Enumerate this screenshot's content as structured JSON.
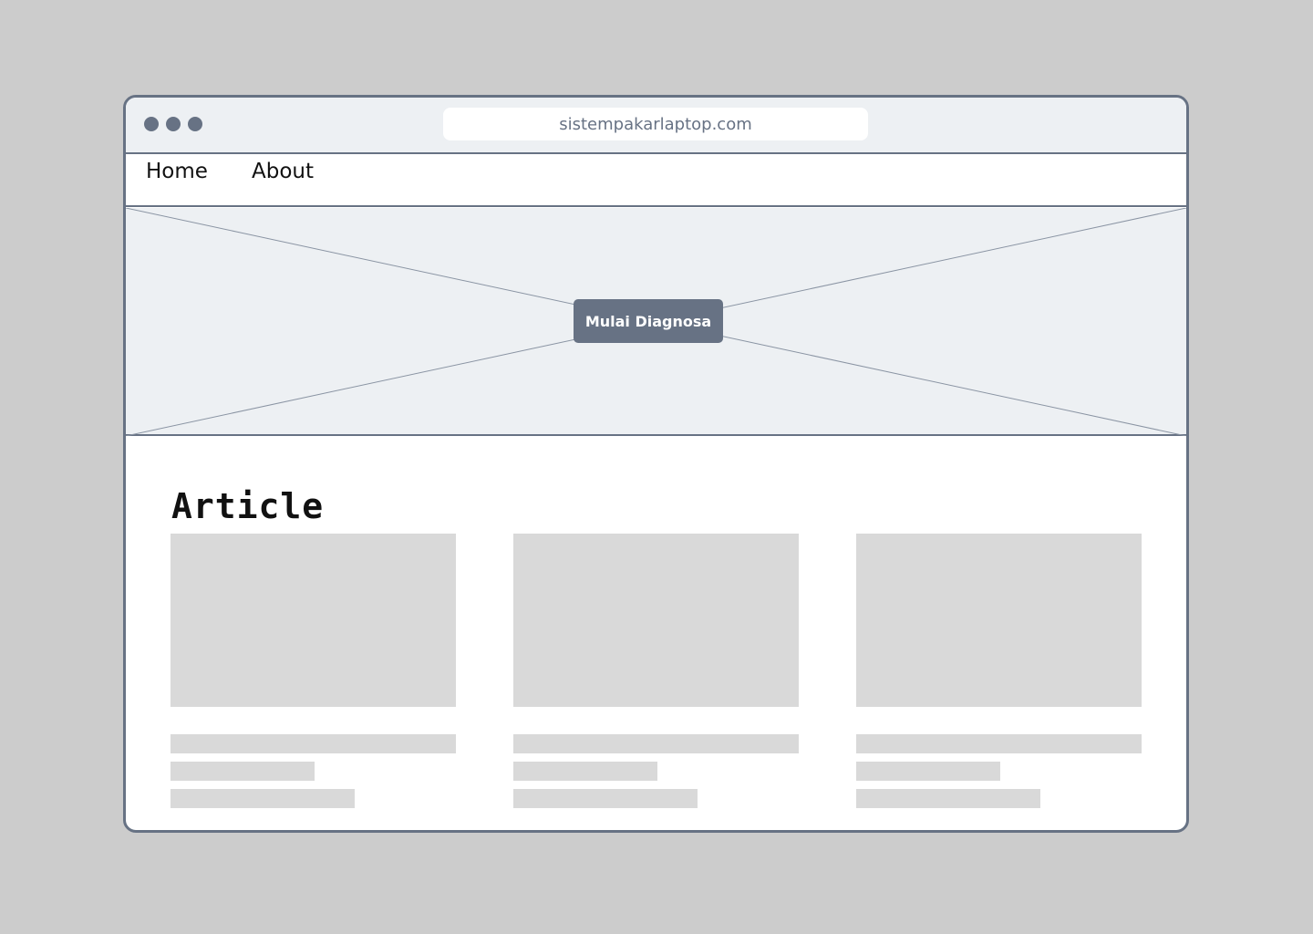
{
  "browser": {
    "url": "sistempakarlaptop.com",
    "window_controls": [
      "window-dot",
      "window-dot",
      "window-dot"
    ]
  },
  "nav": {
    "home": "Home",
    "about": "About"
  },
  "hero": {
    "button_label": "Mulai Diagnosa"
  },
  "articles": {
    "title": "Article",
    "cards": [
      {
        "placeholder": true
      },
      {
        "placeholder": true
      },
      {
        "placeholder": true
      }
    ]
  },
  "colors": {
    "background": "#cccccc",
    "frame": "#677284",
    "hero_bg": "#edf0f3",
    "placeholder": "#d9d9d9",
    "button_text": "#ffffff"
  }
}
